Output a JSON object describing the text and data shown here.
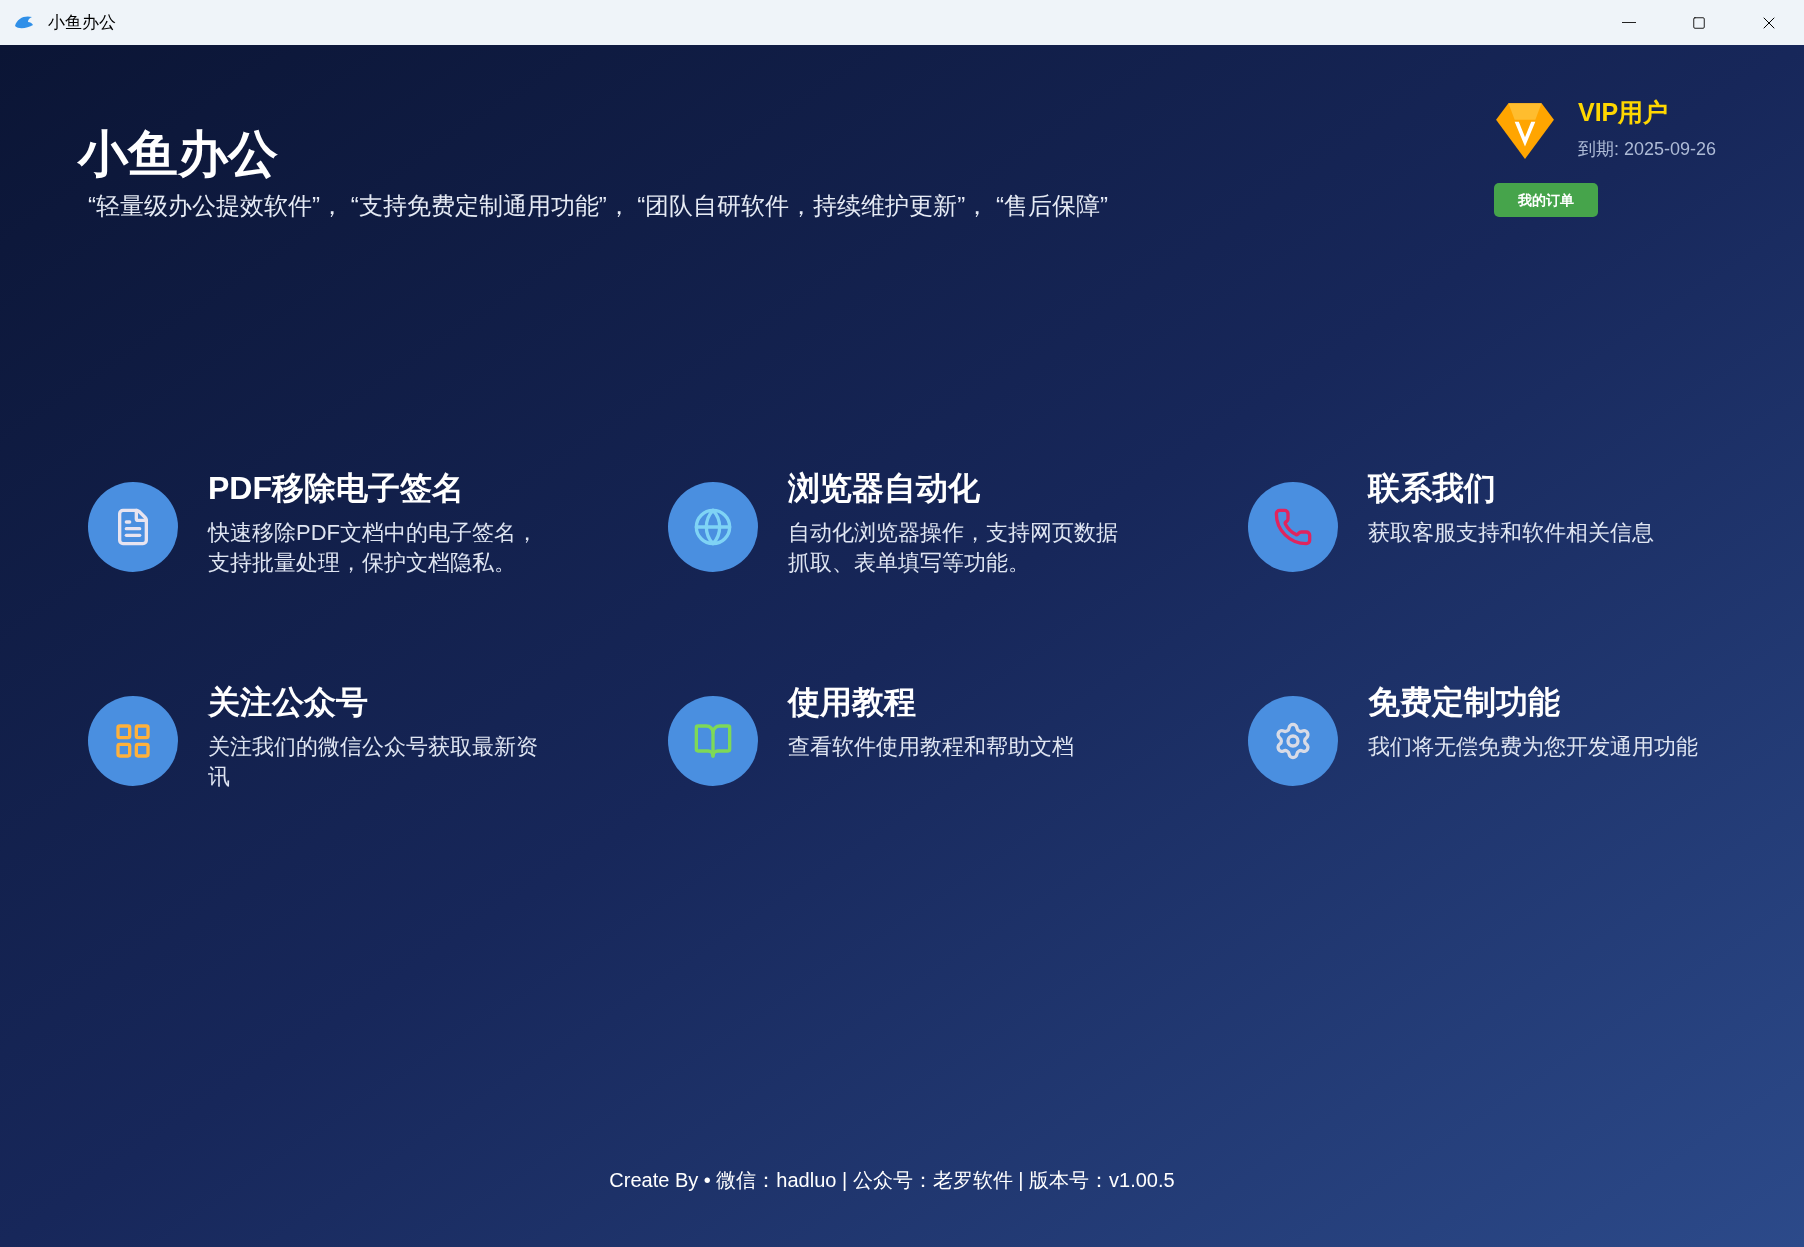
{
  "window": {
    "title": "小鱼办公"
  },
  "header": {
    "title": "小鱼办公",
    "tagline": "“轻量级办公提效软件”， “支持免费定制通用功能”， “团队自研软件，持续维护更新”， “售后保障”"
  },
  "vip": {
    "label": "VIP用户",
    "expiry": "到期: 2025-09-26",
    "button": "我的订单"
  },
  "features": [
    {
      "kind": "document",
      "title": "PDF移除电子签名",
      "description_lines": [
        "快速移除PDF文档中的电子签名，",
        "支持批量处理，保护文档隐私。"
      ]
    },
    {
      "kind": "globe",
      "title": "浏览器自动化",
      "description_lines": [
        "自动化浏览器操作，支持网页数据",
        "抓取、表单填写等功能。"
      ]
    },
    {
      "kind": "phone",
      "title": "联系我们",
      "description_lines": [
        "获取客服支持和软件相关信息"
      ]
    },
    {
      "kind": "apps",
      "title": "关注公众号",
      "description_lines": [
        "关注我们的微信公众号获取最新资",
        "讯"
      ]
    },
    {
      "kind": "books",
      "title": "使用教程",
      "description_lines": [
        "查看软件使用教程和帮助文档"
      ]
    },
    {
      "kind": "gear",
      "title": "免费定制功能",
      "description_lines": [
        "我们将无偿免费为您开发通用功能"
      ]
    }
  ],
  "footer": "Create By • 微信：hadluo | 公众号：老罗软件 | 版本号：v1.00.5"
}
